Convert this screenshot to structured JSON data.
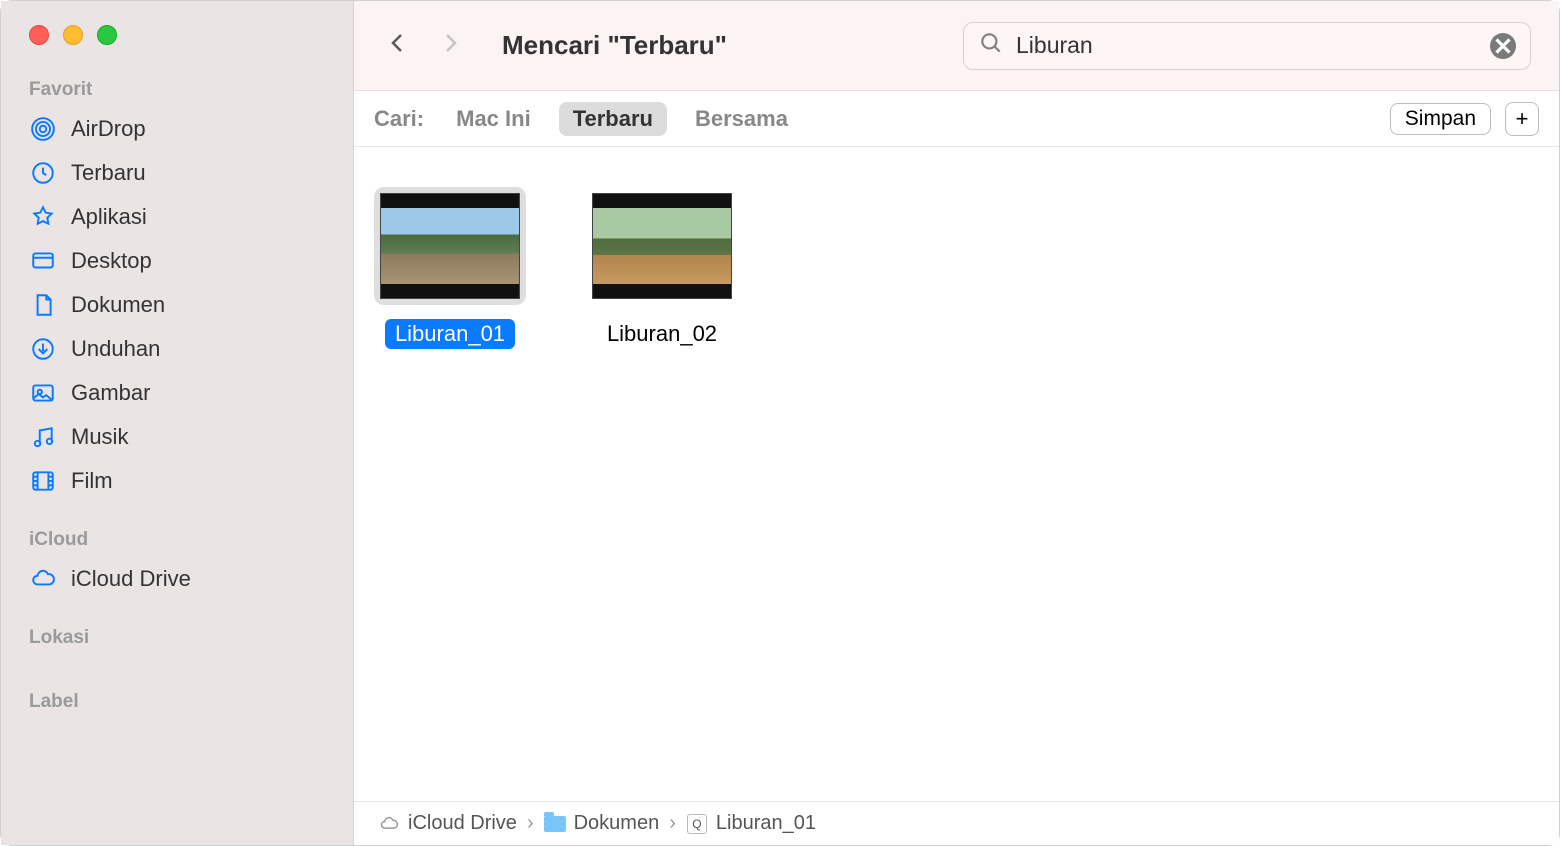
{
  "sidebar": {
    "sections": {
      "favorites": {
        "header": "Favorit",
        "items": [
          {
            "label": "AirDrop"
          },
          {
            "label": "Terbaru"
          },
          {
            "label": "Aplikasi"
          },
          {
            "label": "Desktop"
          },
          {
            "label": "Dokumen"
          },
          {
            "label": "Unduhan"
          },
          {
            "label": "Gambar"
          },
          {
            "label": "Musik"
          },
          {
            "label": "Film"
          }
        ]
      },
      "icloud": {
        "header": "iCloud",
        "items": [
          {
            "label": "iCloud Drive"
          }
        ]
      },
      "locations": {
        "header": "Lokasi"
      },
      "labels": {
        "header": "Label"
      }
    }
  },
  "toolbar": {
    "title": "Mencari \"Terbaru\""
  },
  "search": {
    "value": "Liburan"
  },
  "scope": {
    "label": "Cari:",
    "options": [
      "Mac Ini",
      "Terbaru",
      "Bersama"
    ],
    "save": "Simpan",
    "plus": "+"
  },
  "results": [
    {
      "name": "Liburan_01",
      "selected": true
    },
    {
      "name": "Liburan_02",
      "selected": false
    }
  ],
  "pathbar": {
    "crumbs": [
      "iCloud Drive",
      "Dokumen",
      "Liburan_01"
    ]
  }
}
